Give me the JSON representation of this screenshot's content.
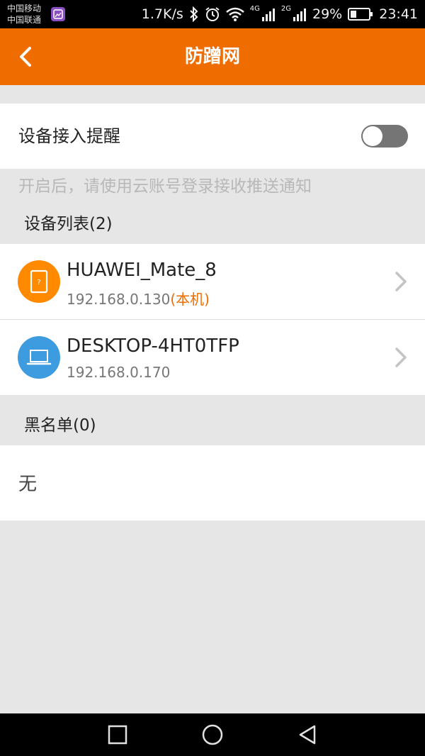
{
  "status_bar": {
    "carrier_1": "中国移动",
    "carrier_2": "中国联通",
    "net_speed": "1.7K/s",
    "net_tag_1": "4G",
    "net_tag_2": "2G",
    "battery": "29%",
    "time": "23:41",
    "icons": [
      "gallery-icon",
      "bluetooth-icon",
      "alarm-icon",
      "wifi-icon",
      "signal-icon",
      "battery-icon"
    ]
  },
  "app_bar": {
    "title": "防蹭网",
    "accent_color": "#ef6c00"
  },
  "reminder": {
    "label": "设备接入提醒",
    "enabled": false,
    "hint": "开启后，请使用云账号登录接收推送通知"
  },
  "device_list": {
    "header": "设备列表(2)",
    "items": [
      {
        "name": "HUAWEI_Mate_8",
        "ip": "192.168.0.130",
        "tag": "(本机)",
        "icon": "phone-icon",
        "icon_color": "#ff8a00"
      },
      {
        "name": "DESKTOP-4HT0TFP",
        "ip": "192.168.0.170",
        "tag": "",
        "icon": "laptop-icon",
        "icon_color": "#3d9be0"
      }
    ]
  },
  "blacklist": {
    "header": "黑名单(0)",
    "empty_text": "无"
  },
  "nav_bar": {
    "icons": [
      "recent-apps-icon",
      "home-icon",
      "back-icon"
    ]
  }
}
